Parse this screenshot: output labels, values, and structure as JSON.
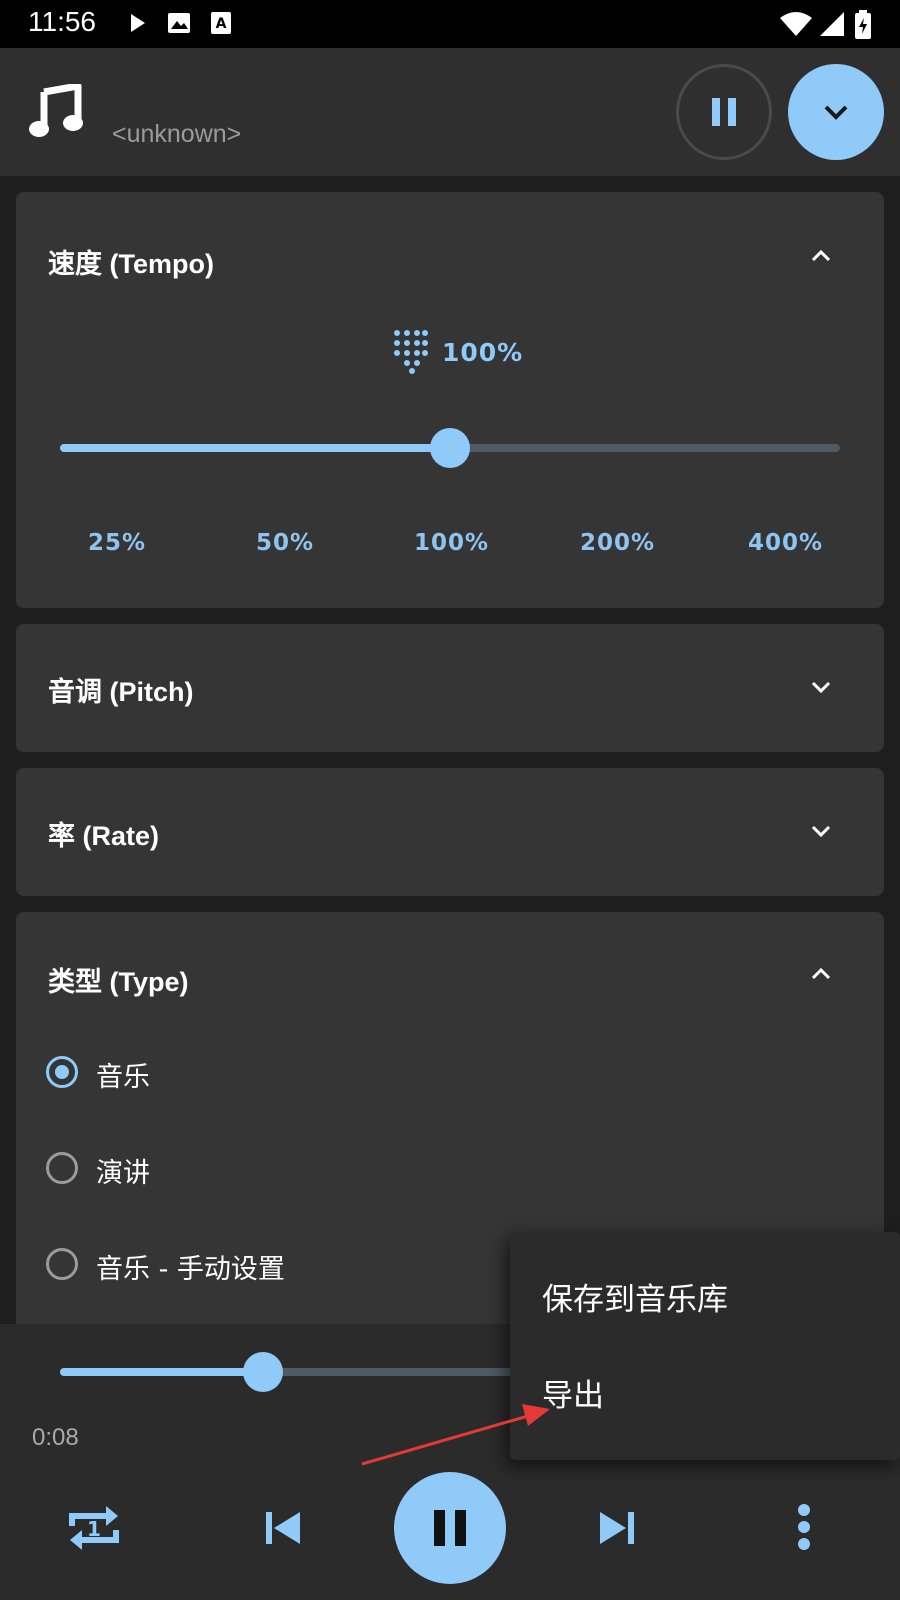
{
  "status_bar": {
    "time": "11:56"
  },
  "header": {
    "subtitle": "<unknown>"
  },
  "tempo": {
    "title": "速度 (Tempo)",
    "value_label": "100%",
    "ticks": [
      "25%",
      "50%",
      "100%",
      "200%",
      "400%"
    ],
    "slider_fraction": 0.5
  },
  "pitch": {
    "title": "音调 (Pitch)"
  },
  "rate": {
    "title": "率 (Rate)"
  },
  "type": {
    "title": "类型 (Type)",
    "options": [
      "音乐",
      "演讲",
      "音乐 - 手动设置"
    ],
    "selected_index": 0
  },
  "player": {
    "elapsed": "0:08",
    "progress_fraction": 0.26
  },
  "menu": {
    "items": [
      "保存到音乐库",
      "导出"
    ]
  },
  "colors": {
    "accent": "#90caf9",
    "card": "#353535",
    "background": "#1e1e1e"
  },
  "icons": [
    "play-icon",
    "image-icon",
    "text-icon",
    "wifi-icon",
    "signal-icon",
    "battery-icon",
    "music-note-icon",
    "pause-icon",
    "chevron-down-icon",
    "chevron-up-icon",
    "keypad-icon",
    "repeat-one-icon",
    "skip-previous-icon",
    "skip-next-icon",
    "more-vert-icon"
  ]
}
